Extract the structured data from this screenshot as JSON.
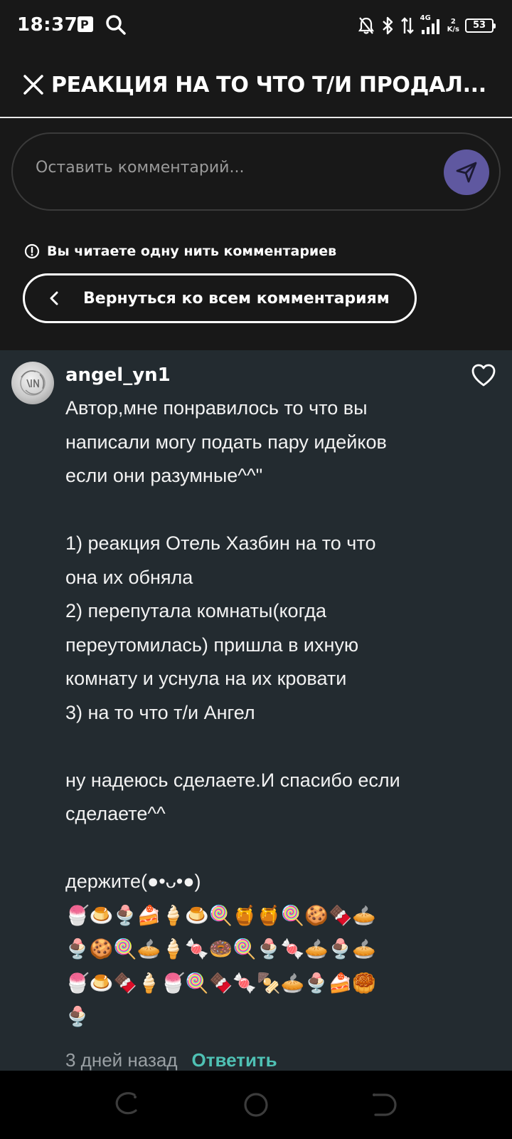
{
  "status_bar": {
    "time": "18:37",
    "network_type": "4G",
    "speed_value": "2",
    "speed_unit": "K/s",
    "battery": "53"
  },
  "header": {
    "title": "РЕАКЦИЯ НА ТО ЧТО Т/И ПРОДАЛ..."
  },
  "comment_input": {
    "placeholder": "Оставить комментарий..."
  },
  "thread_notice": "Вы читаете одну нить комментариев",
  "back_button": {
    "label": "Вернуться ко всем комментариям"
  },
  "comment": {
    "username": "angel_yn1",
    "text": "Автор,мне понравилось то что вы\nнаписали могу подать пару идейков\nесли они разумные^^\"\n\n1) реакция Отель Хазбин на то что\nона их обняла\n2) перепутала комнаты(когда\nпереутомилась) пришла в ихную\nкомнату и уснула на их кровати\n3) на то что т/и Ангел\n\nну надеюсь сделаете.И спасибо если\nсделаете^^\n\nдержите(●•ᴗ•●)\n🍧🍮🍨🍰🍦🍮🍭🍯🍯🍭🍪🍫🥧\n🍨🍪🍭🥧🍦🍬🍩🍭🍨🍬🥧🍨🥧\n🍧🍮🍫🍦🍧🍭🍫🍬🍢🥧🍨🍰🥮\n🍨",
    "time_ago": "3 дней назад",
    "reply_label": "Ответить"
  },
  "colors": {
    "background": "#181818",
    "thread_background": "#232b30",
    "send_button": "#5f58a0",
    "reply_accent": "#4fc1b4"
  },
  "icons": {
    "close": "close-icon",
    "send": "send-icon",
    "info": "info-icon",
    "back": "chevron-left-icon",
    "like": "heart-icon"
  }
}
